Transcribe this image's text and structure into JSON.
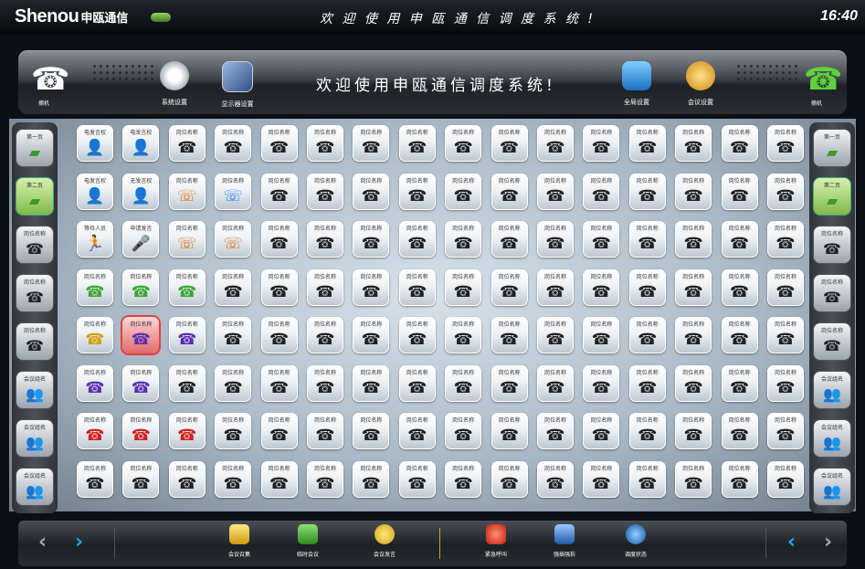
{
  "titlebar": {
    "logo_text": "Shenou",
    "logo_cn": "申瓯通信",
    "marquee": "欢 迎 使 用 申 瓯 通 信 调 度 系 统 !",
    "clock": "16:40"
  },
  "toolbar": {
    "welcome": "欢迎使用申瓯通信调度系统!",
    "left_phone_label": "摘机",
    "right_phone_label": "摘机",
    "buttons": [
      {
        "label": "系统设置",
        "icon": "gear-icon",
        "color": "#dfe3e8"
      },
      {
        "label": "显示器设置",
        "icon": "display-settings-icon",
        "color": "#5a7fb5"
      },
      {
        "label": "全局设置",
        "icon": "computer-icon",
        "color": "#3a8de0"
      },
      {
        "label": "会议设置",
        "icon": "meeting-settings-icon",
        "color": "#e0a030"
      }
    ]
  },
  "sidebar_left": [
    {
      "label": "第一页",
      "icon": "page-icon",
      "active": false
    },
    {
      "label": "第二页",
      "icon": "page-icon",
      "active": true
    },
    {
      "label": "岗位名称",
      "icon": "phone-icon",
      "active": false
    },
    {
      "label": "岗位名称",
      "icon": "phone-icon",
      "active": false
    },
    {
      "label": "岗位名称",
      "icon": "phone-icon",
      "active": false
    },
    {
      "label": "会议组名",
      "icon": "group-icon",
      "active": false
    },
    {
      "label": "会议组名",
      "icon": "group-icon",
      "active": false
    },
    {
      "label": "会议组名",
      "icon": "group-icon",
      "active": false
    }
  ],
  "sidebar_right": [
    {
      "label": "第一页",
      "icon": "page-icon",
      "active": false
    },
    {
      "label": "第二页",
      "icon": "page-icon",
      "active": true
    },
    {
      "label": "岗位名称",
      "icon": "phone-icon",
      "active": false
    },
    {
      "label": "岗位名称",
      "icon": "phone-icon",
      "active": false
    },
    {
      "label": "岗位名称",
      "icon": "phone-icon",
      "active": false
    },
    {
      "label": "会议组名",
      "icon": "group-icon",
      "active": false
    },
    {
      "label": "会议组名",
      "icon": "group-icon",
      "active": false
    },
    {
      "label": "会议组名",
      "icon": "group-icon",
      "active": false
    }
  ],
  "grid": {
    "columns": 16,
    "default_label": "岗位名称",
    "rows": [
      [
        {
          "label": "电发言权",
          "icon": "user-icon"
        },
        {
          "label": "电发言权",
          "icon": "user-icon"
        }
      ],
      [
        {
          "label": "电发言权",
          "icon": "user-icon"
        },
        {
          "label": "无发言权",
          "icon": "user-icon"
        },
        {
          "label": "岗位名称",
          "icon": "calling-icon"
        },
        {
          "label": "岗位名称",
          "icon": "dialing-icon"
        }
      ],
      [
        {
          "label": "等待人员",
          "icon": "runner-icon"
        },
        {
          "label": "申请发言",
          "icon": "mic-icon"
        },
        {
          "label": "岗位名称",
          "icon": "calling-icon"
        },
        {
          "label": "岗位名称",
          "icon": "call-transfer-icon"
        }
      ],
      [
        {
          "label": "岗位名称",
          "icon": "green-call-icon"
        },
        {
          "label": "岗位名称",
          "icon": "green-call-icon"
        },
        {
          "label": "岗位名称",
          "icon": "green-call-icon"
        }
      ],
      [
        {
          "label": "岗位名称",
          "icon": "gold-phone-icon"
        },
        {
          "label": "岗位名称",
          "icon": "purple-phone-icon",
          "selected": true
        },
        {
          "label": "岗位名称",
          "icon": "purple-phone-icon"
        }
      ],
      [
        {
          "label": "岗位名称",
          "icon": "purple-phone-icon"
        },
        {
          "label": "岗位名称",
          "icon": "purple-phone-icon"
        }
      ],
      [
        {
          "label": "岗位名称",
          "icon": "red-phone-icon"
        },
        {
          "label": "岗位名称",
          "icon": "red-phone-icon"
        },
        {
          "label": "岗位名称",
          "icon": "red-phone-icon"
        }
      ],
      []
    ]
  },
  "bottombar": {
    "prev": "‹",
    "next": "›",
    "buttons": [
      {
        "label": "会议召集",
        "icon": "meeting-call-icon",
        "color": "#e8c030"
      },
      {
        "label": "临时会议",
        "icon": "temp-meeting-icon",
        "color": "#3fb040"
      },
      {
        "label": "会议发言",
        "icon": "speech-icon",
        "color": "#f0c020"
      },
      {
        "label": "紧急呼叫",
        "icon": "alarm-icon",
        "color": "#e03020"
      },
      {
        "label": "强插强拆",
        "icon": "force-icon",
        "color": "#2a70c0"
      },
      {
        "label": "调度状态",
        "icon": "status-globe-icon",
        "color": "#2060b0"
      }
    ]
  }
}
